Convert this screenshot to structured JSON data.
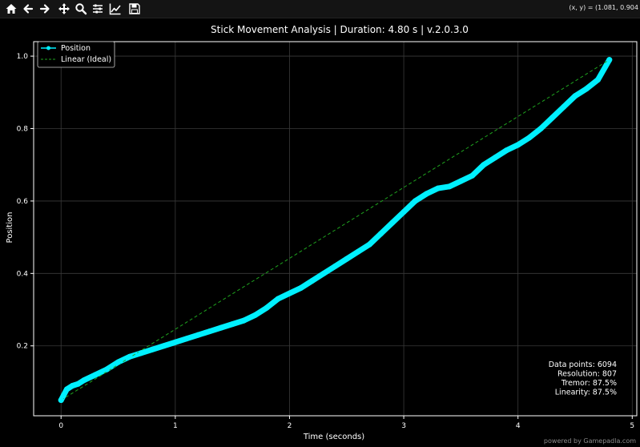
{
  "toolbar": {
    "buttons": [
      "home-icon",
      "back-arrow-icon",
      "forward-arrow-icon",
      "pan-icon",
      "zoom-icon",
      "subplots-config-icon",
      "axes-edit-icon",
      "save-icon"
    ],
    "coords_readout": "(x, y) = (1.081, 0.904"
  },
  "watermark": "powered by Gamepadla.com",
  "colors": {
    "background": "#000000",
    "position": "#00f0ff",
    "linear": "#1fa31f",
    "grid": "#3a3a3a",
    "text": "#ffffff"
  },
  "chart_data": {
    "type": "line",
    "title": "Stick Movement Analysis | Duration: 4.80 s | v.2.0.3.0",
    "xlabel": "Time (seconds)",
    "ylabel": "Position",
    "xlim": [
      -0.24,
      5.04
    ],
    "ylim": [
      0.007,
      1.04
    ],
    "xticks": [
      0,
      1,
      2,
      3,
      4,
      5
    ],
    "yticks": [
      0.2,
      0.4,
      0.6,
      0.8,
      1.0
    ],
    "xtick_labels": [
      "0",
      "1",
      "2",
      "3",
      "4",
      "5"
    ],
    "ytick_labels": [
      "0.2",
      "0.4",
      "0.6",
      "0.8",
      "1.0"
    ],
    "grid": true,
    "legend_position": "top-left",
    "series": [
      {
        "name": "Position",
        "style": "line-with-markers",
        "x": [
          0,
          0.05,
          0.1,
          0.15,
          0.2,
          0.3,
          0.4,
          0.5,
          0.6,
          0.7,
          0.8,
          0.9,
          1.0,
          1.1,
          1.2,
          1.3,
          1.4,
          1.5,
          1.6,
          1.7,
          1.8,
          1.9,
          2.0,
          2.1,
          2.2,
          2.3,
          2.4,
          2.5,
          2.6,
          2.7,
          2.8,
          2.9,
          3.0,
          3.1,
          3.2,
          3.3,
          3.4,
          3.5,
          3.6,
          3.7,
          3.8,
          3.9,
          4.0,
          4.1,
          4.2,
          4.3,
          4.4,
          4.5,
          4.6,
          4.7,
          4.8
        ],
        "y": [
          0.05,
          0.08,
          0.09,
          0.095,
          0.105,
          0.12,
          0.135,
          0.155,
          0.17,
          0.18,
          0.19,
          0.2,
          0.21,
          0.22,
          0.23,
          0.24,
          0.25,
          0.26,
          0.27,
          0.285,
          0.305,
          0.33,
          0.345,
          0.36,
          0.38,
          0.4,
          0.42,
          0.44,
          0.46,
          0.48,
          0.51,
          0.54,
          0.57,
          0.6,
          0.62,
          0.635,
          0.64,
          0.655,
          0.67,
          0.7,
          0.72,
          0.74,
          0.755,
          0.775,
          0.8,
          0.83,
          0.86,
          0.89,
          0.91,
          0.935,
          0.99
        ]
      },
      {
        "name": "Linear (Ideal)",
        "style": "dashed",
        "x": [
          0,
          4.8
        ],
        "y": [
          0.05,
          0.99
        ]
      }
    ],
    "stats": [
      "Data points: 6094",
      "Resolution: 807",
      "Tremor: 87.5%",
      "Linearity: 87.5%"
    ]
  }
}
